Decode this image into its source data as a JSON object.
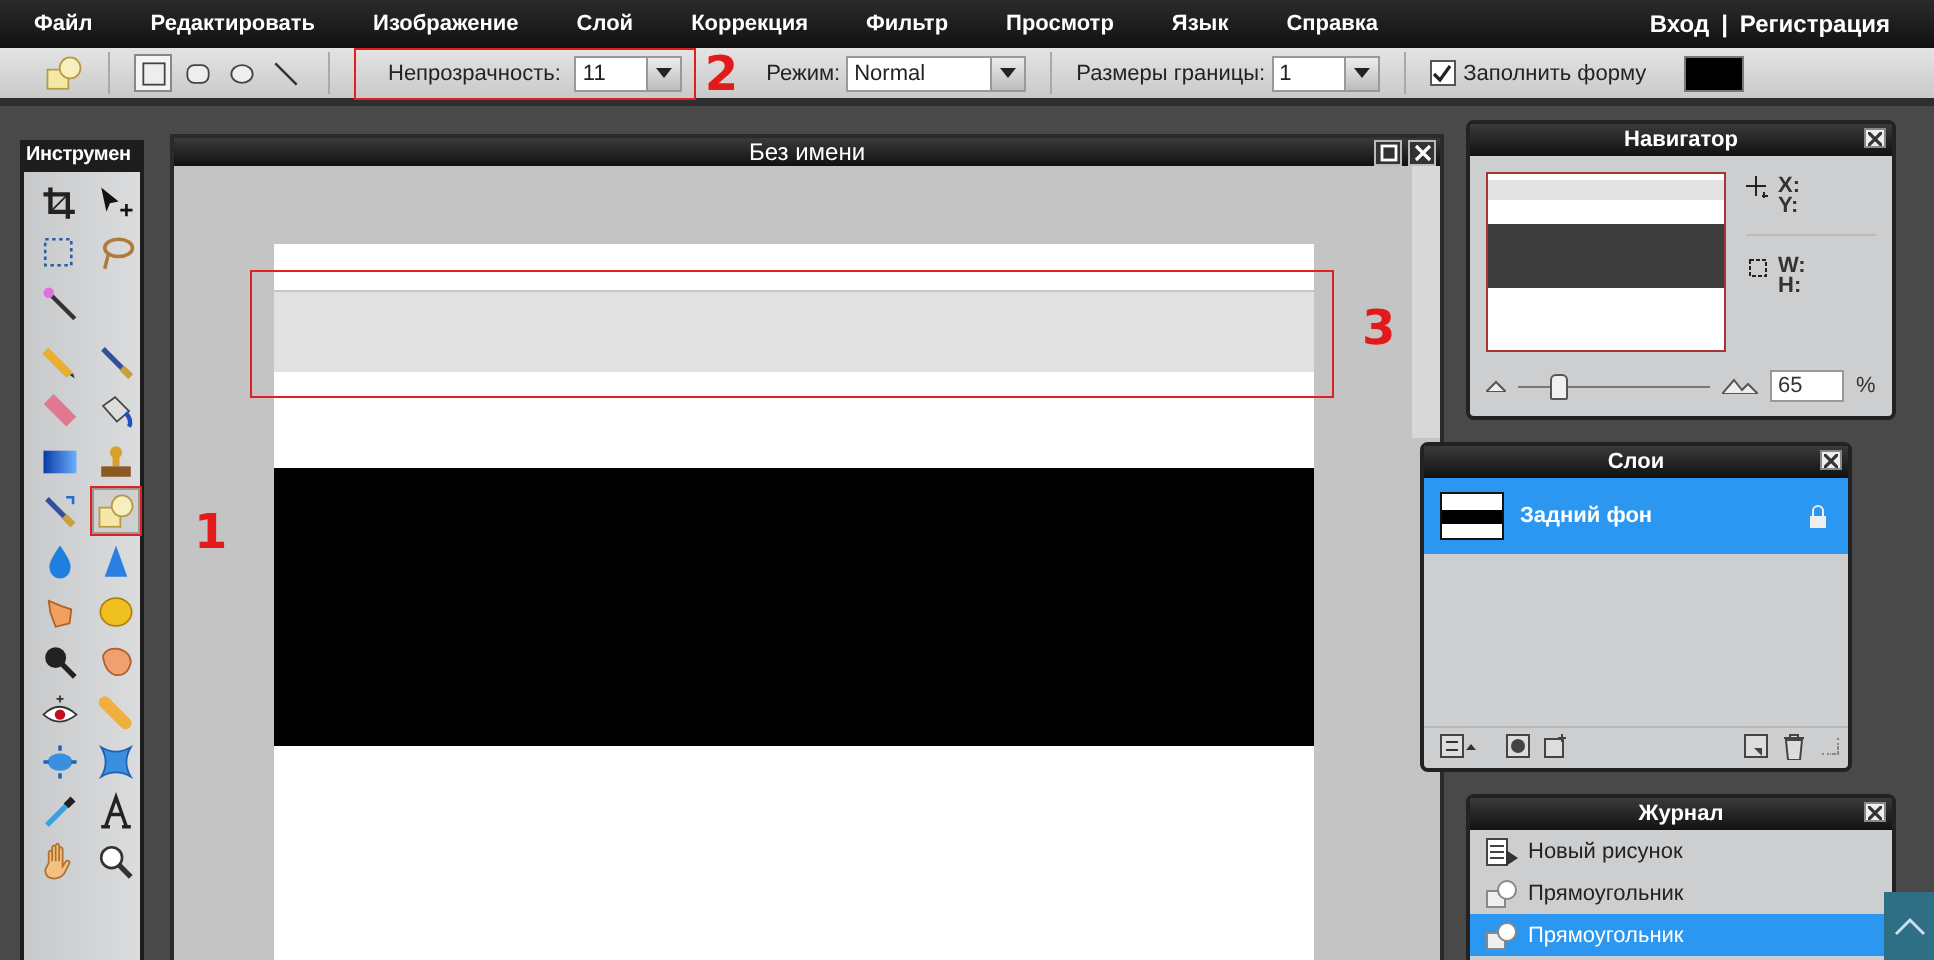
{
  "menu": {
    "items": [
      "Файл",
      "Редактировать",
      "Изображение",
      "Слой",
      "Коррекция",
      "Фильтр",
      "Просмотр",
      "Язык",
      "Справка"
    ],
    "login": "Вход",
    "separator": "|",
    "register": "Регистрация"
  },
  "options": {
    "shapes": [
      {
        "selected": true
      },
      {
        "selected": false
      },
      {
        "selected": false
      },
      {
        "selected": false
      }
    ],
    "opacity": {
      "label": "Непрозрачность:",
      "value": "11"
    },
    "mode": {
      "label": "Режим:",
      "value": "Normal"
    },
    "border": {
      "label": "Размеры границы:",
      "value": "1"
    },
    "fill": {
      "label": "Заполнить форму",
      "checked": true,
      "color": "#000000"
    }
  },
  "tools": {
    "title": "Инструмен",
    "items": [
      {
        "selected": false
      },
      {
        "selected": false
      },
      {
        "selected": false
      },
      {
        "selected": false
      },
      {
        "selected": false
      },
      {
        "selected": false
      },
      {
        "selected": false
      },
      {
        "selected": false
      },
      {
        "selected": false
      },
      {
        "selected": false
      },
      {
        "selected": false
      },
      {
        "selected": false
      },
      {
        "selected": true
      },
      {
        "selected": false
      },
      {
        "selected": false
      },
      {
        "selected": false
      },
      {
        "selected": false
      },
      {
        "selected": false
      },
      {
        "selected": false
      },
      {
        "selected": false
      },
      {
        "selected": false
      },
      {
        "selected": false
      },
      {
        "selected": false
      },
      {
        "selected": false
      },
      {
        "selected": false
      },
      {
        "selected": false
      },
      {
        "selected": false
      }
    ]
  },
  "document": {
    "title": "Без имени"
  },
  "navigator": {
    "title": "Навигатор",
    "x": "X:",
    "y": "Y:",
    "w": "W:",
    "h": "H:",
    "zoom": {
      "level": 0.2,
      "value": "65",
      "unit": "%"
    }
  },
  "layers": {
    "title": "Слои",
    "items": [
      {
        "name": "Задний фон",
        "selected": true,
        "locked": true
      }
    ]
  },
  "history": {
    "title": "Журнал",
    "items": [
      {
        "name": "Новый рисунок",
        "kind": "new",
        "selected": false
      },
      {
        "name": "Прямоугольник",
        "kind": "shape",
        "selected": false
      },
      {
        "name": "Прямоугольник",
        "kind": "shape",
        "selected": true
      }
    ]
  },
  "annotations": [
    {
      "label": "1"
    },
    {
      "label": "2"
    },
    {
      "label": "3"
    }
  ]
}
